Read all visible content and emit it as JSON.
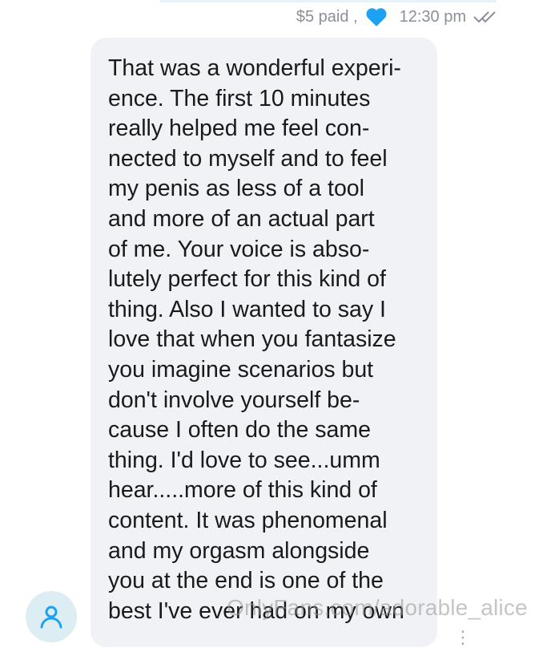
{
  "message_meta": {
    "price": "$5 paid ,",
    "liked_icon": "heart-icon",
    "time": "12:30 pm",
    "read_icon": "double-check-icon"
  },
  "message": {
    "text": "That was a wonderful experi-\nence. The first 10 minutes\nreally helped me feel con-\nnected to myself and to feel\nmy penis as less of a tool\nand more of an actual part\nof me. Your voice is abso-\nlutely perfect for this kind of\nthing. Also I wanted to say I\nlove that when you fantasize\nyou imagine scenarios but\ndon't involve yourself be-\ncause I often do the same\nthing. I'd love to see...umm\nhear.....more of this kind of\ncontent. It was phenomenal\nand my orgasm alongside\nyou at the end is one of the\nbest I've ever had on my own"
  },
  "watermark": "OnlyFans.com/adorable_alice",
  "more_indicator": "⋮",
  "colors": {
    "accent": "#1da1f2",
    "bubble": "#f0f2f5",
    "meta_text": "#8a8f98",
    "avatar_bg": "#dcedf3"
  }
}
